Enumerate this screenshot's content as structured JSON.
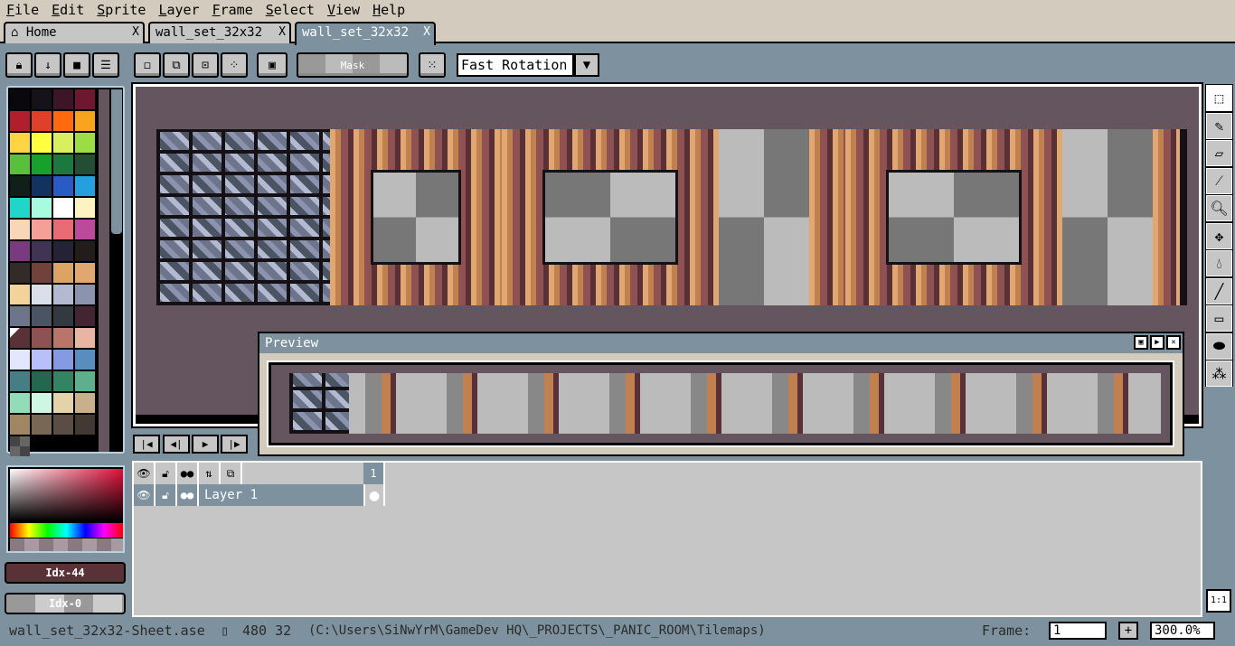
{
  "menu": [
    "File",
    "Edit",
    "Sprite",
    "Layer",
    "Frame",
    "Select",
    "View",
    "Help"
  ],
  "tabs": [
    {
      "label": "Home",
      "icon": "home-icon"
    },
    {
      "label": "wall_set_32x32"
    },
    {
      "label": "wall_set_32x32"
    }
  ],
  "tab_close": "X",
  "toolbar": {
    "mask_label": "Mask",
    "rotation_algorithm": "Fast Rotation"
  },
  "palette": [
    "#0a080c",
    "#16121a",
    "#3c1626",
    "#6e1830",
    "#b21f2c",
    "#e0402a",
    "#ff6a10",
    "#f8a41c",
    "#ffd442",
    "#ffff40",
    "#d8f060",
    "#9cdc44",
    "#58c03a",
    "#16a02c",
    "#1c783e",
    "#224e36",
    "#121e1a",
    "#14325e",
    "#285cc4",
    "#24a0e0",
    "#20d6c8",
    "#a6fcdc",
    "#ffffff",
    "#fef3c0",
    "#fad6b8",
    "#f5a097",
    "#e86a73",
    "#bc4a9b",
    "#793a80",
    "#403353",
    "#242234",
    "#221c1a",
    "#322b28",
    "#71413b",
    "#dca464",
    "#e0a870",
    "#f4d29c",
    "#dae0ea",
    "#b3b9d1",
    "#8b93af",
    "#6d758d",
    "#4a5462",
    "#333941",
    "#422433",
    "#5b3138",
    "#8e5252",
    "#ba756a",
    "#e9b5a3",
    "#e3e6ff",
    "#b9bffb",
    "#849be4",
    "#588dbe",
    "#477d85",
    "#23674e",
    "#328464",
    "#5daf8d",
    "#92dcba",
    "#cdf7e2",
    "#e4d2aa",
    "#c7b08b",
    "#a08662",
    "#796755",
    "#5a4e44",
    "#423934"
  ],
  "fg_color": {
    "label": "Idx-44",
    "hex": "#5b3138"
  },
  "bg_color": {
    "label": "Idx-0"
  },
  "preview": {
    "title": "Preview"
  },
  "timeline": {
    "frame_number": "1",
    "layer_name": "Layer 1"
  },
  "tools": [
    "rectangular-marquee",
    "pencil",
    "eraser",
    "eyedropper",
    "zoom",
    "move",
    "paint-bucket",
    "line",
    "rectangle",
    "contour",
    "spray"
  ],
  "zoom_reset": "1:1",
  "status": {
    "filename": "wall_set_32x32-Sheet.ase",
    "size": "480 32",
    "path": "(C:\\Users\\SiNwYrM\\GameDev HQ\\_PROJECTS\\_PANIC_ROOM\\Tilemaps)",
    "frame_label": "Frame:",
    "frame_value": "1",
    "add": "+",
    "zoom": "300.0%"
  }
}
